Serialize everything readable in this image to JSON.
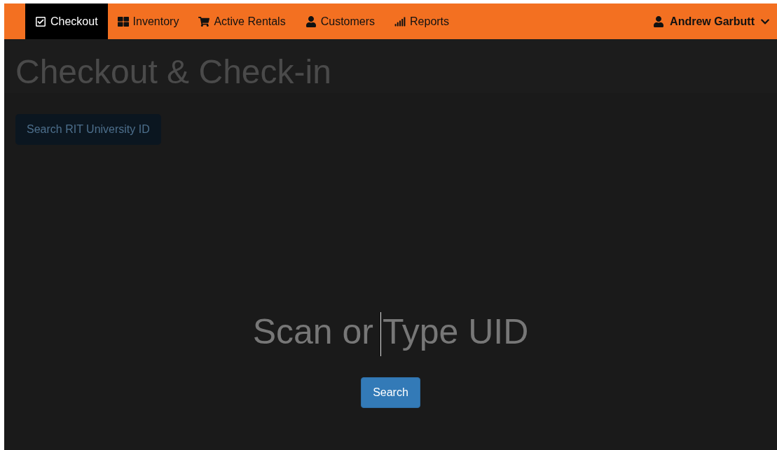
{
  "navbar": {
    "tabs": [
      {
        "label": "Checkout",
        "selected": true
      },
      {
        "label": "Inventory",
        "selected": false
      },
      {
        "label": "Active Rentals",
        "selected": false
      },
      {
        "label": "Customers",
        "selected": false
      },
      {
        "label": "Reports",
        "selected": false
      }
    ],
    "user_menu": {
      "label": "Andrew Garbutt"
    }
  },
  "page": {
    "title": "Checkout & Check-in",
    "button": "Search RIT University ID"
  },
  "overlay": {
    "uid_field": {
      "placeholder": "Scan or Type UID"
    },
    "search_button": "Search"
  }
}
